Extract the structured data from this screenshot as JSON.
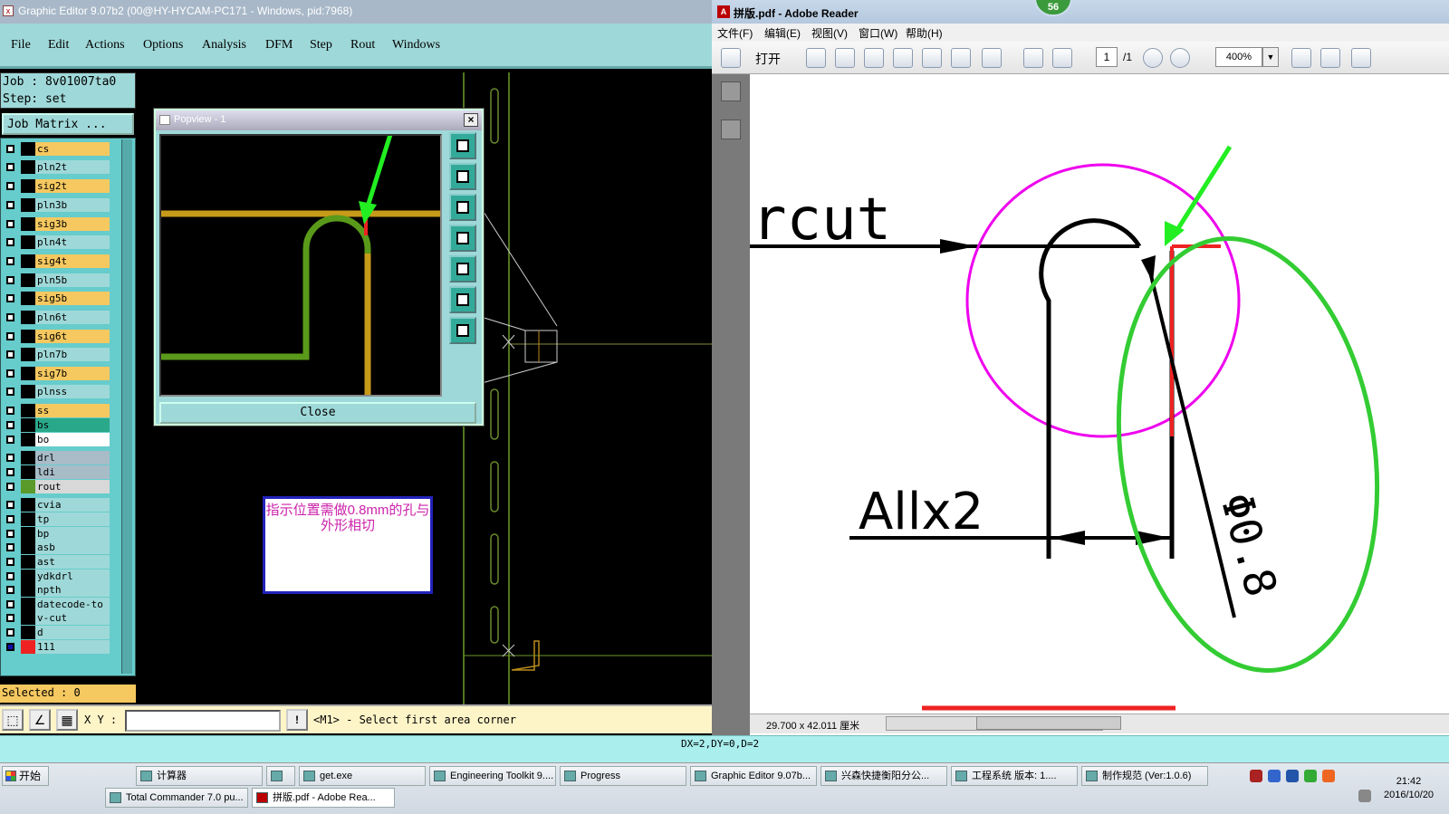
{
  "left_app": {
    "title": "Graphic Editor 9.07b2 (00@HY-HYCAM-PC171 - Windows, pid:7968)",
    "menu": [
      "File",
      "Edit",
      "Actions",
      "Options",
      "Analysis",
      "DFM",
      "Step",
      "Rout",
      "Windows"
    ],
    "job_label": "Job : 8v01007ta0",
    "step_label": "Step: set",
    "job_matrix": "Job Matrix ...",
    "layers": [
      {
        "name": "cs",
        "color": "#f5c860",
        "sw": "#000"
      },
      {
        "name": "pln2t",
        "color": "#9fd8d8",
        "sw": "#000"
      },
      {
        "name": "sig2t",
        "color": "#f5c860",
        "sw": "#000"
      },
      {
        "name": "pln3b",
        "color": "#9fd8d8",
        "sw": "#000"
      },
      {
        "name": "sig3b",
        "color": "#f5c860",
        "sw": "#000"
      },
      {
        "name": "pln4t",
        "color": "#9fd8d8",
        "sw": "#000"
      },
      {
        "name": "sig4t",
        "color": "#f5c860",
        "sw": "#000"
      },
      {
        "name": "pln5b",
        "color": "#9fd8d8",
        "sw": "#000"
      },
      {
        "name": "sig5b",
        "color": "#f5c860",
        "sw": "#000"
      },
      {
        "name": "pln6t",
        "color": "#9fd8d8",
        "sw": "#000"
      },
      {
        "name": "sig6t",
        "color": "#f5c860",
        "sw": "#000"
      },
      {
        "name": "pln7b",
        "color": "#9fd8d8",
        "sw": "#000"
      },
      {
        "name": "sig7b",
        "color": "#f5c860",
        "sw": "#000"
      },
      {
        "name": "plnss",
        "color": "#9fd8d8",
        "sw": "#000"
      },
      {
        "name": "ss",
        "color": "#f5c860",
        "sw": "#000"
      },
      {
        "name": "bs",
        "color": "#2aa88a",
        "sw": "#000"
      },
      {
        "name": "bo",
        "color": "#ffffff",
        "sw": "#000"
      },
      {
        "name": "drl",
        "color": "#a8bcc8",
        "sw": "#000"
      },
      {
        "name": "ldi",
        "color": "#a8bcc8",
        "sw": "#000"
      },
      {
        "name": "rout",
        "color": "#d8d8d8",
        "sw": "#5a9a2a"
      },
      {
        "name": "cvia",
        "color": "#9fd8d8",
        "sw": "#000"
      },
      {
        "name": "tp",
        "color": "#9fd8d8",
        "sw": "#000"
      },
      {
        "name": "bp",
        "color": "#9fd8d8",
        "sw": "#000"
      },
      {
        "name": "asb",
        "color": "#9fd8d8",
        "sw": "#000"
      },
      {
        "name": "ast",
        "color": "#9fd8d8",
        "sw": "#000"
      },
      {
        "name": "ydkdrl",
        "color": "#9fd8d8",
        "sw": "#000"
      },
      {
        "name": "npth",
        "color": "#9fd8d8",
        "sw": "#000"
      },
      {
        "name": "datecode-to",
        "color": "#9fd8d8",
        "sw": "#000"
      },
      {
        "name": "v-cut",
        "color": "#9fd8d8",
        "sw": "#000"
      },
      {
        "name": "d",
        "color": "#9fd8d8",
        "sw": "#000"
      },
      {
        "name": "111",
        "color": "#9fd8d8",
        "sw": "#e22"
      }
    ],
    "selected": "Selected : 0",
    "xy_label": "X Y :",
    "prompt": "<M1> - Select first area corner",
    "status": "DX=2,DY=0,D=2",
    "popview": {
      "title": "Popview - 1",
      "close": "Close"
    },
    "note": "指示位置需做0.8mm的孔与外形相切"
  },
  "right_app": {
    "title": "拼版.pdf - Adobe Reader",
    "badge": "56",
    "menu": [
      "文件(F)",
      "编辑(E)",
      "视图(V)",
      "窗口(W)",
      "帮助(H)"
    ],
    "open_label": "打开",
    "page_current": "1",
    "page_total": "/1",
    "zoom": "400%",
    "drawing": {
      "cut_text": "rcut",
      "dim_text": "Allx2",
      "dia_text": "Φ0.8"
    },
    "page_size": "29.700 x 42.011 厘米"
  },
  "taskbar": {
    "start": "开始",
    "row1": [
      "计算器",
      "",
      "get.exe",
      "Engineering Toolkit 9....",
      "Progress",
      "Graphic Editor 9.07b...",
      "兴森快捷衡阳分公...",
      "工程系统  版本: 1....",
      "制作规范 (Ver:1.0.6)"
    ],
    "row2": [
      "Total Commander 7.0 pu...",
      "拼版.pdf - Adobe Rea..."
    ],
    "time": "21:42",
    "date": "2016/10/20"
  }
}
